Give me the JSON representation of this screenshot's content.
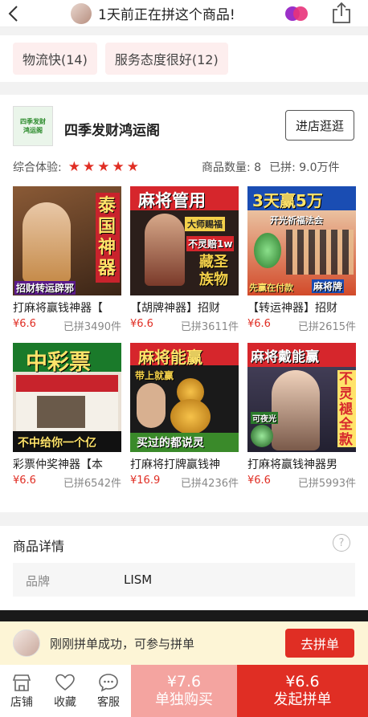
{
  "topbar": {
    "notice_text": "1天前正在拼这个商品!"
  },
  "tags": [
    "物流快(14)",
    "服务态度很好(12)"
  ],
  "shop": {
    "logo_text": "四季发财鸿运阁",
    "name": "四季发财鸿运阁",
    "visit_label": "进店逛逛",
    "rating_label": "综合体验:",
    "rating_stars": 5,
    "count_label": "商品数量: 8",
    "sold_label": "已拼: 9.0万件"
  },
  "products": [
    {
      "name": "打麻将赢钱神器【",
      "price": "¥6.6",
      "sold": "已拼3490件",
      "img_text": [
        "泰国神器",
        "招财转运辟邪"
      ],
      "colors": [
        "#7a4a2a",
        "#c8232c"
      ]
    },
    {
      "name": "【胡牌神器】招财",
      "price": "¥6.6",
      "sold": "已拼3611件",
      "img_text": [
        "麻将管用",
        "大师赐福",
        "不灵赔1w",
        "藏圣族物"
      ],
      "colors": [
        "#2b1e1a",
        "#d6262c"
      ]
    },
    {
      "name": "【转运神器】招财",
      "price": "¥6.6",
      "sold": "已拼2615件",
      "img_text": [
        "3天赢5万",
        "开光祈福法会",
        "先赢在付款",
        "麻将牌"
      ],
      "colors": [
        "#e04a24",
        "#1a4db3"
      ]
    },
    {
      "name": "彩票仲奖神器【本",
      "price": "¥6.6",
      "sold": "已拼6542件",
      "img_text": [
        "中彩票",
        "不中给你一个亿"
      ],
      "colors": [
        "#1a7a2a",
        "#c8232c"
      ]
    },
    {
      "name": "打麻将打牌赢钱神",
      "price": "¥16.9",
      "sold": "已拼4236件",
      "img_text": [
        "麻将能赢",
        "带上就赢",
        "买过的都说灵"
      ],
      "colors": [
        "#1a1a1a",
        "#d6262c"
      ]
    },
    {
      "name": "打麻将赢钱神器男",
      "price": "¥6.6",
      "sold": "已拼5993件",
      "img_text": [
        "麻将戴能赢",
        "不灵褪全款",
        "可夜光"
      ],
      "colors": [
        "#3a3550",
        "#d6262c"
      ]
    }
  ],
  "detail": {
    "title": "商品详情",
    "brand_key": "品牌",
    "brand_value": "LISM"
  },
  "join": {
    "text": "刚刚拼单成功，可参与拼单",
    "button": "去拼单"
  },
  "bottom": {
    "shop_label": "店铺",
    "fav_label": "收藏",
    "service_label": "客服",
    "single_price": "¥7.6",
    "single_label": "单独购买",
    "group_price": "¥6.6",
    "group_label": "发起拼单"
  }
}
